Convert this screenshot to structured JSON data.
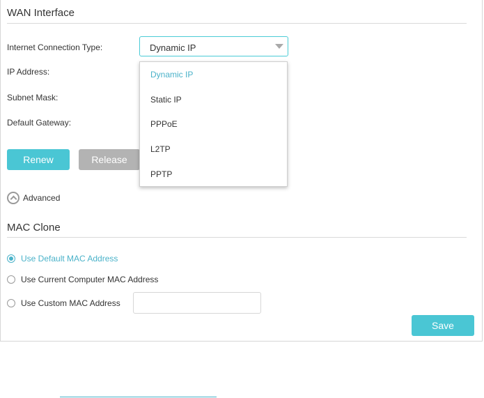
{
  "wan": {
    "title": "WAN Interface",
    "connection_type_label": "Internet Connection Type:",
    "connection_type_value": "Dynamic IP",
    "ip_label": "IP Address:",
    "subnet_label": "Subnet Mask:",
    "gateway_label": "Default Gateway:",
    "dropdown_options": [
      "Dynamic IP",
      "Static IP",
      "PPPoE",
      "L2TP",
      "PPTP"
    ],
    "renew_label": "Renew",
    "release_label": "Release",
    "advanced_label": "Advanced"
  },
  "mac_clone": {
    "title": "MAC Clone",
    "options": [
      "Use Default MAC Address",
      "Use Current Computer MAC Address",
      "Use Custom MAC Address"
    ],
    "selected_option": "Use Default MAC Address",
    "custom_mac_value": ""
  },
  "save_label": "Save",
  "colors": {
    "accent": "#4ac6d4",
    "selected_text": "#4ab2c9",
    "disabled_button": "#b3b3b3"
  }
}
